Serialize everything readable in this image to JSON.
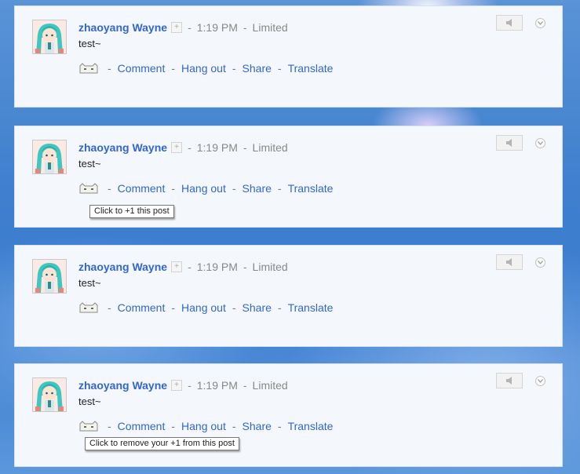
{
  "posts": [
    {
      "author": "zhaoyang Wayne",
      "add_label": "+",
      "sep": "-",
      "time": "1:19 PM",
      "visibility": "Limited",
      "text": "test~",
      "actions": {
        "comment": "Comment",
        "hangout": "Hang out",
        "share": "Share",
        "translate": "Translate"
      },
      "tooltip": ""
    },
    {
      "author": "zhaoyang Wayne",
      "add_label": "+",
      "sep": "-",
      "time": "1:19 PM",
      "visibility": "Limited",
      "text": "test~",
      "actions": {
        "comment": "Comment",
        "hangout": "Hang out",
        "share": "Share",
        "translate": "Translate"
      },
      "tooltip": "Click to +1 this post"
    },
    {
      "author": "zhaoyang Wayne",
      "add_label": "+",
      "sep": "-",
      "time": "1:19 PM",
      "visibility": "Limited",
      "text": "test~",
      "actions": {
        "comment": "Comment",
        "hangout": "Hang out",
        "share": "Share",
        "translate": "Translate"
      },
      "tooltip": ""
    },
    {
      "author": "zhaoyang Wayne",
      "add_label": "+",
      "sep": "-",
      "time": "1:19 PM",
      "visibility": "Limited",
      "text": "test~",
      "actions": {
        "comment": "Comment",
        "hangout": "Hang out",
        "share": "Share",
        "translate": "Translate"
      },
      "tooltip": "Click to remove your +1 from this post"
    }
  ],
  "icons": {
    "avatar": "anime-avatar-icon",
    "plusone": "cat-face-icon",
    "mute": "speaker-icon",
    "options": "chevron-down-icon"
  },
  "colors": {
    "link": "#3366cc",
    "meta": "#888888",
    "card_bg": "#f4f8fc",
    "page_bg": "#3f7fce"
  }
}
